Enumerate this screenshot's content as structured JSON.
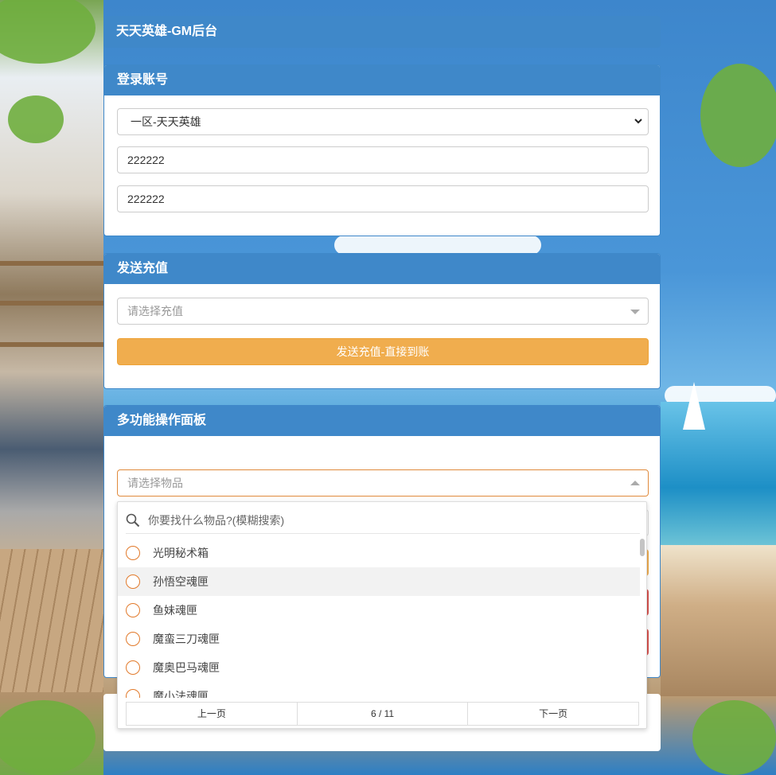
{
  "header": {
    "title": "天天英雄-GM后台"
  },
  "login": {
    "title": "登录账号",
    "server_selected": "一区-天天英雄",
    "account_value": "222222",
    "password_value": "222222"
  },
  "recharge": {
    "title": "发送充值",
    "select_placeholder": "请选择充值",
    "send_button": "发送充值-直接到账"
  },
  "multi": {
    "title": "多功能操作面板",
    "item_select_placeholder": "请选择物品"
  },
  "dropdown": {
    "search_placeholder": "你要找什么物品?(模糊搜索)",
    "items": [
      {
        "label": "光明秘术箱"
      },
      {
        "label": "孙悟空魂匣"
      },
      {
        "label": "鱼妹魂匣"
      },
      {
        "label": "魔蛮三刀魂匣"
      },
      {
        "label": "魔奥巴马魂匣"
      },
      {
        "label": "魔小法魂匣"
      }
    ],
    "pager": {
      "prev": "上一页",
      "page": "6 / 11",
      "next": "下一页"
    }
  },
  "icons": {
    "chevron": "chevron-down-icon",
    "search": "search-icon",
    "radio": "radio-icon"
  },
  "colors": {
    "panel_header": "#3f88c9",
    "orange_button": "#f0ad4e",
    "radio_border": "#e27a2b"
  }
}
